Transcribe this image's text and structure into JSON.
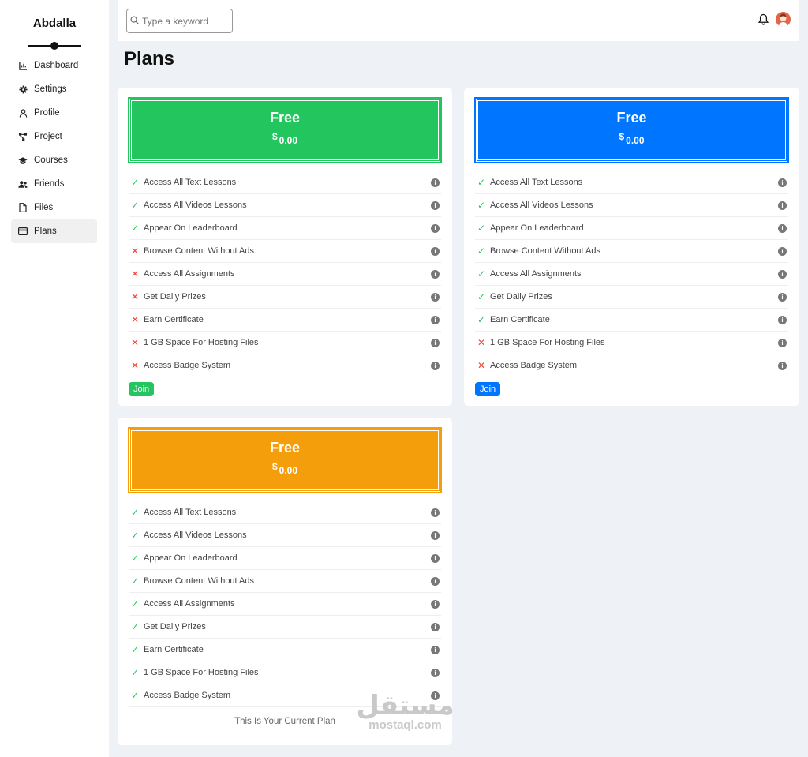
{
  "sidebar": {
    "brand": "Abdalla",
    "items": [
      {
        "label": "Dashboard",
        "icon": "chart-icon"
      },
      {
        "label": "Settings",
        "icon": "gear-icon"
      },
      {
        "label": "Profile",
        "icon": "user-icon"
      },
      {
        "label": "Project",
        "icon": "diagram-icon"
      },
      {
        "label": "Courses",
        "icon": "graduation-cap-icon"
      },
      {
        "label": "Friends",
        "icon": "users-icon"
      },
      {
        "label": "Files",
        "icon": "file-icon"
      },
      {
        "label": "Plans",
        "icon": "credit-card-icon",
        "active": true
      }
    ]
  },
  "header": {
    "search_placeholder": "Type a keyword"
  },
  "page": {
    "title": "Plans"
  },
  "plans": [
    {
      "name": "Free",
      "currency": "$",
      "price": "0.00",
      "color": "#22c55e",
      "button": "Join",
      "features": [
        {
          "label": "Access All Text Lessons",
          "included": true
        },
        {
          "label": "Access All Videos Lessons",
          "included": true
        },
        {
          "label": "Appear On Leaderboard",
          "included": true
        },
        {
          "label": "Browse Content Without Ads",
          "included": false
        },
        {
          "label": "Access All Assignments",
          "included": false
        },
        {
          "label": "Get Daily Prizes",
          "included": false
        },
        {
          "label": "Earn Certificate",
          "included": false
        },
        {
          "label": "1 GB Space For Hosting Files",
          "included": false
        },
        {
          "label": "Access Badge System",
          "included": false
        }
      ]
    },
    {
      "name": "Free",
      "currency": "$",
      "price": "0.00",
      "color": "#0075ff",
      "button": "Join",
      "features": [
        {
          "label": "Access All Text Lessons",
          "included": true
        },
        {
          "label": "Access All Videos Lessons",
          "included": true
        },
        {
          "label": "Appear On Leaderboard",
          "included": true
        },
        {
          "label": "Browse Content Without Ads",
          "included": true
        },
        {
          "label": "Access All Assignments",
          "included": true
        },
        {
          "label": "Get Daily Prizes",
          "included": true
        },
        {
          "label": "Earn Certificate",
          "included": true
        },
        {
          "label": "1 GB Space For Hosting Files",
          "included": false
        },
        {
          "label": "Access Badge System",
          "included": false
        }
      ]
    },
    {
      "name": "Free",
      "currency": "$",
      "price": "0.00",
      "color": "#f59e0b",
      "current_text": "This Is Your Current Plan",
      "features": [
        {
          "label": "Access All Text Lessons",
          "included": true
        },
        {
          "label": "Access All Videos Lessons",
          "included": true
        },
        {
          "label": "Appear On Leaderboard",
          "included": true
        },
        {
          "label": "Browse Content Without Ads",
          "included": true
        },
        {
          "label": "Access All Assignments",
          "included": true
        },
        {
          "label": "Get Daily Prizes",
          "included": true
        },
        {
          "label": "Earn Certificate",
          "included": true
        },
        {
          "label": "1 GB Space For Hosting Files",
          "included": true
        },
        {
          "label": "Access Badge System",
          "included": true
        }
      ]
    }
  ],
  "watermark": {
    "arabic": "مستقل",
    "latin": "mostaql.com"
  }
}
